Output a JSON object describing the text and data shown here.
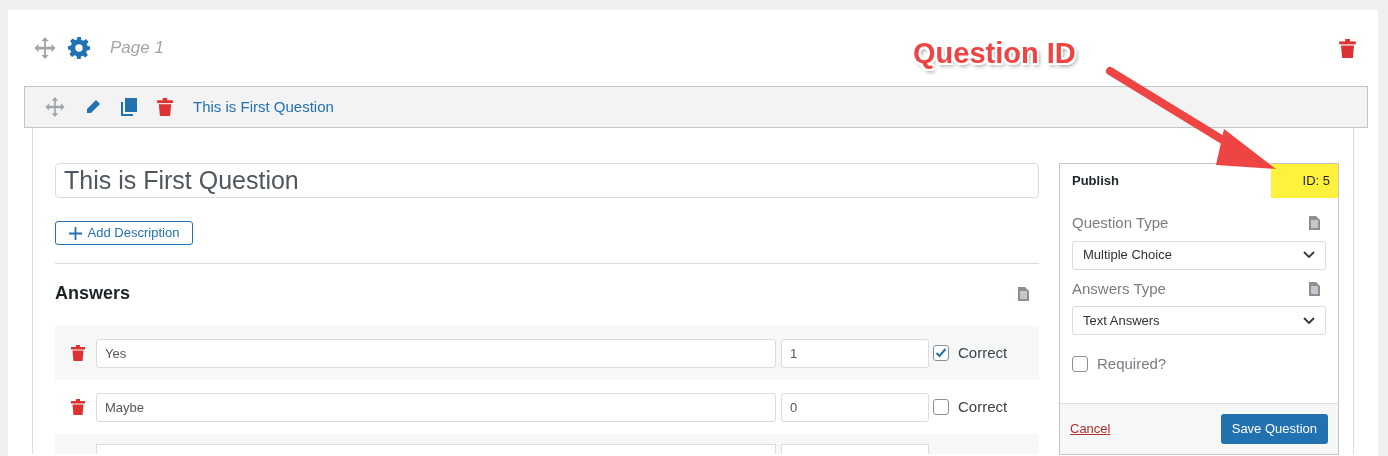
{
  "page": {
    "title": "Page 1"
  },
  "annotation": {
    "text": "Question ID"
  },
  "question_bar": {
    "title": "This is First Question"
  },
  "editor": {
    "title_value": "This is First Question",
    "add_description": "Add Description",
    "answers_heading": "Answers",
    "answers": [
      {
        "value": "Yes",
        "points": "1",
        "checked": true,
        "label": "Correct"
      },
      {
        "value": "Maybe",
        "points": "0",
        "checked": false,
        "label": "Correct"
      }
    ]
  },
  "publish": {
    "title": "Publish",
    "id": "ID: 5",
    "fields": [
      {
        "label": "Question Type",
        "value": "Multiple Choice"
      },
      {
        "label": "Answers Type",
        "value": "Text Answers"
      }
    ],
    "required": {
      "label": "Required?",
      "checked": false
    },
    "cancel": "Cancel",
    "save": "Save Question"
  }
}
